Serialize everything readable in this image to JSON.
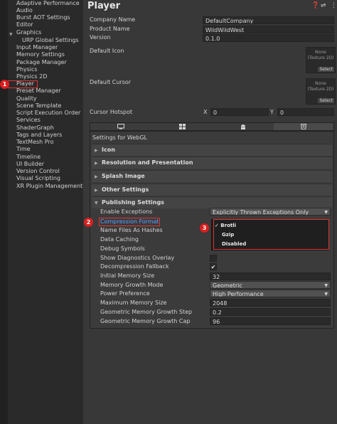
{
  "sidebar": {
    "items": [
      {
        "label": "Adaptive Performance"
      },
      {
        "label": "Audio"
      },
      {
        "label": "Burst AOT Settings"
      },
      {
        "label": "Editor"
      },
      {
        "label": "Graphics"
      },
      {
        "label": "URP Global Settings"
      },
      {
        "label": "Input Manager"
      },
      {
        "label": "Memory Settings"
      },
      {
        "label": "Package Manager"
      },
      {
        "label": "Physics"
      },
      {
        "label": "Physics 2D"
      },
      {
        "label": "Player"
      },
      {
        "label": "Preset Manager"
      },
      {
        "label": "Quality"
      },
      {
        "label": "Scene Template"
      },
      {
        "label": "Script Execution Order"
      },
      {
        "label": "Services"
      },
      {
        "label": "ShaderGraph"
      },
      {
        "label": "Tags and Layers"
      },
      {
        "label": "TextMesh Pro"
      },
      {
        "label": "Time"
      },
      {
        "label": "Timeline"
      },
      {
        "label": "UI Builder"
      },
      {
        "label": "Version Control"
      },
      {
        "label": "Visual Scripting"
      },
      {
        "label": "XR Plugin Management"
      }
    ]
  },
  "markers": {
    "m1": "1",
    "m2": "2",
    "m3": "3"
  },
  "header": {
    "title": "Player",
    "icons": [
      "help-icon",
      "preset-icon",
      "more-icon"
    ]
  },
  "player": {
    "company_label": "Company Name",
    "company_value": "DefaultCompany",
    "product_label": "Product Name",
    "product_value": "WildWildWest",
    "version_label": "Version",
    "version_value": "0.1.0",
    "default_icon_label": "Default Icon",
    "default_icon_none": "None",
    "default_icon_type": "(Texture 2D)",
    "default_icon_select": "Select",
    "default_cursor_label": "Default Cursor",
    "default_cursor_none": "None",
    "default_cursor_type": "(Texture 2D)",
    "default_cursor_select": "Select",
    "hotspot_label": "Cursor Hotspot",
    "hotspot_x_label": "X",
    "hotspot_x_value": "0",
    "hotspot_y_label": "Y",
    "hotspot_y_value": "0"
  },
  "platform_tabs": [
    "standalone-icon",
    "webgl-grid-icon",
    "android-icon",
    "html5-icon"
  ],
  "settings_title": "Settings for WebGL",
  "sections": {
    "icon": "Icon",
    "resolution": "Resolution and Presentation",
    "splash": "Splash Image",
    "other": "Other Settings",
    "publishing": "Publishing Settings"
  },
  "publishing": {
    "enable_exceptions_label": "Enable Exceptions",
    "enable_exceptions_value": "Explicitly Thrown Exceptions Only",
    "compression_label": "Compression Format",
    "name_files_label": "Name Files As Hashes",
    "data_caching_label": "Data Caching",
    "debug_symbols_label": "Debug Symbols",
    "show_diag_label": "Show Diagnostics Overlay",
    "decompression_label": "Decompression Fallback",
    "decompression_check": "✔",
    "initial_memory_label": "Initial Memory Size",
    "initial_memory_value": "32",
    "growth_mode_label": "Memory Growth Mode",
    "growth_mode_value": "Geometric",
    "power_pref_label": "Power Preference",
    "power_pref_value": "High Performance",
    "max_memory_label": "Maximum Memory Size",
    "max_memory_value": "2048",
    "growth_step_label": "Geometric Memory Growth Step",
    "growth_step_value": "0.2",
    "growth_cap_label": "Geometric Memory Growth Cap",
    "growth_cap_value": "96"
  },
  "compression_popup": {
    "brotli": "✓ Brotli",
    "gzip": "Gzip",
    "disabled": "Disabled"
  },
  "colors": {
    "highlight": "#e23232",
    "marker": "#d91f1f",
    "panel": "#383838",
    "sidebar": "#2a2a2a"
  }
}
